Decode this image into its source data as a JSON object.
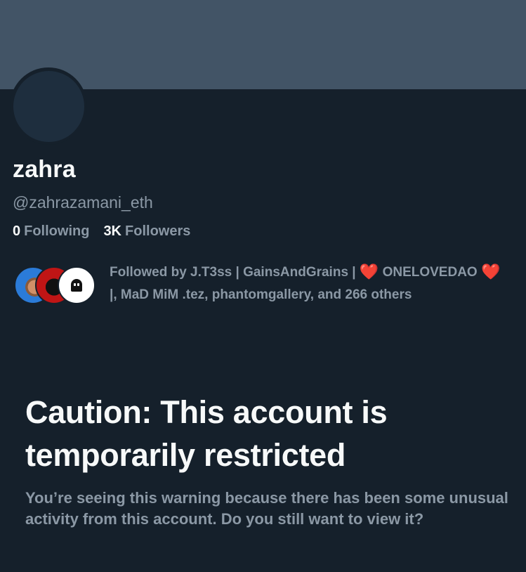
{
  "profile": {
    "display_name": "zahra",
    "handle": "@zahrazamani_eth",
    "following_count": "0",
    "following_label": "Following",
    "followers_count": "3K",
    "followers_label": "Followers"
  },
  "followed_by": {
    "prefix": "Followed by J.T3ss | GainsAndGrains |",
    "name_part1": "ONELOVEDAO",
    "suffix": "|, MaD MiM .tez, phantomgallery, and 266 others",
    "avatars": [
      "user-avatar-1",
      "user-avatar-2",
      "ghost-avatar-icon"
    ]
  },
  "warning": {
    "title": "Caution: This account is temporarily restricted",
    "description": "You’re seeing this warning because there has been some unusual activity from this account. Do you still want to view it?"
  },
  "colors": {
    "background": "#15202b",
    "banner": "#425466",
    "secondary_text": "#8b98a5",
    "primary_text": "#f7f9f9",
    "heart": "#e0245e"
  }
}
